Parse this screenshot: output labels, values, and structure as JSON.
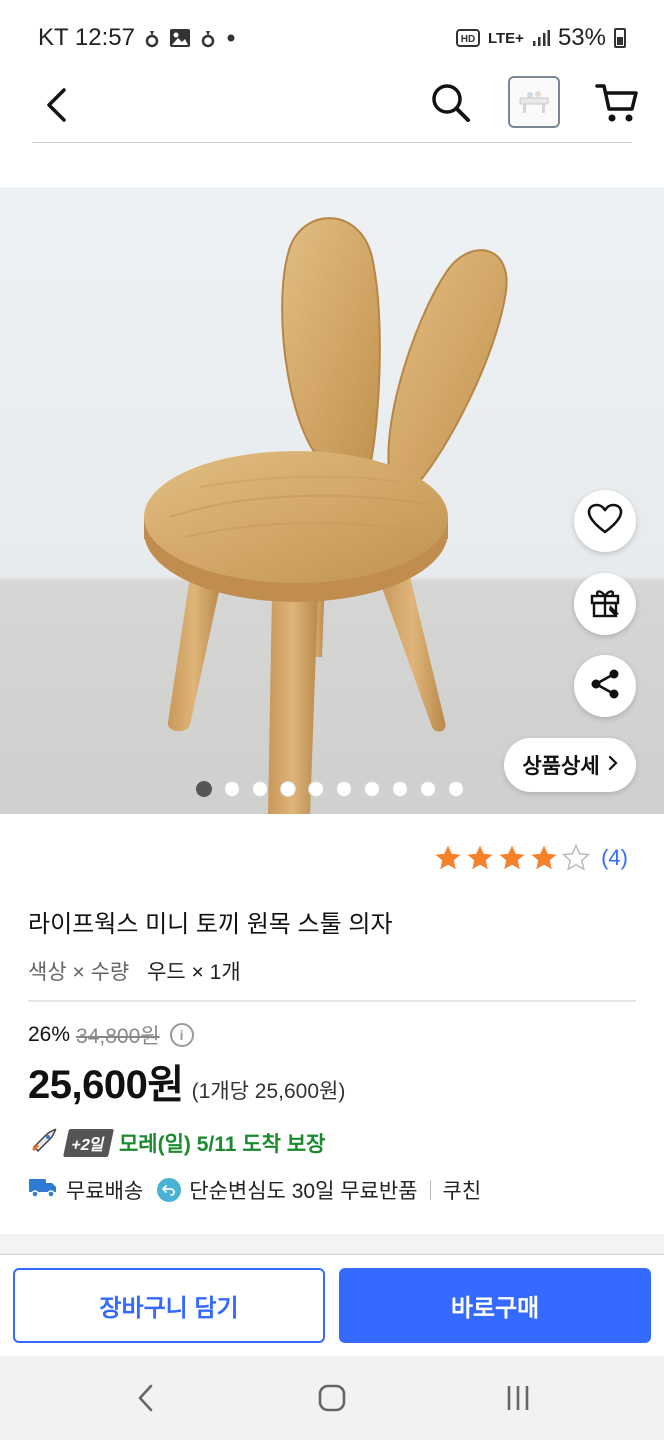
{
  "status_bar": {
    "carrier_time": "KT 12:57",
    "network": "LTE+",
    "battery": "53%"
  },
  "nav": {
    "icons": [
      "back-icon",
      "search-icon",
      "product-thumbnail",
      "cart-icon"
    ]
  },
  "gallery": {
    "image_count": 10,
    "active_index": 0,
    "detail_label": "상품상세",
    "side_buttons": [
      "heart-icon",
      "gift-icon",
      "share-icon"
    ]
  },
  "product": {
    "rating_stars": 4,
    "review_count": "(4)",
    "title": "라이프웍스 미니 토끼 원목 스툴 의자",
    "option_label": "색상 × 수량",
    "option_value": "우드 × 1개",
    "discount": "26%",
    "original_price": "34,800원",
    "price": "25,600원",
    "unit_price": "(1개당 25,600원)"
  },
  "delivery": {
    "badge": "+2일",
    "arrival": "모레(일) 5/11 도착 보장",
    "free_shipping": "무료배송",
    "free_return": "단순변심도 30일 무료반품",
    "seller": "쿠친"
  },
  "actions": {
    "add_to_cart": "장바구니 담기",
    "buy_now": "바로구매"
  },
  "colors": {
    "accent": "#346aff",
    "arrival_green": "#198a2e",
    "star": "#f5822a"
  }
}
